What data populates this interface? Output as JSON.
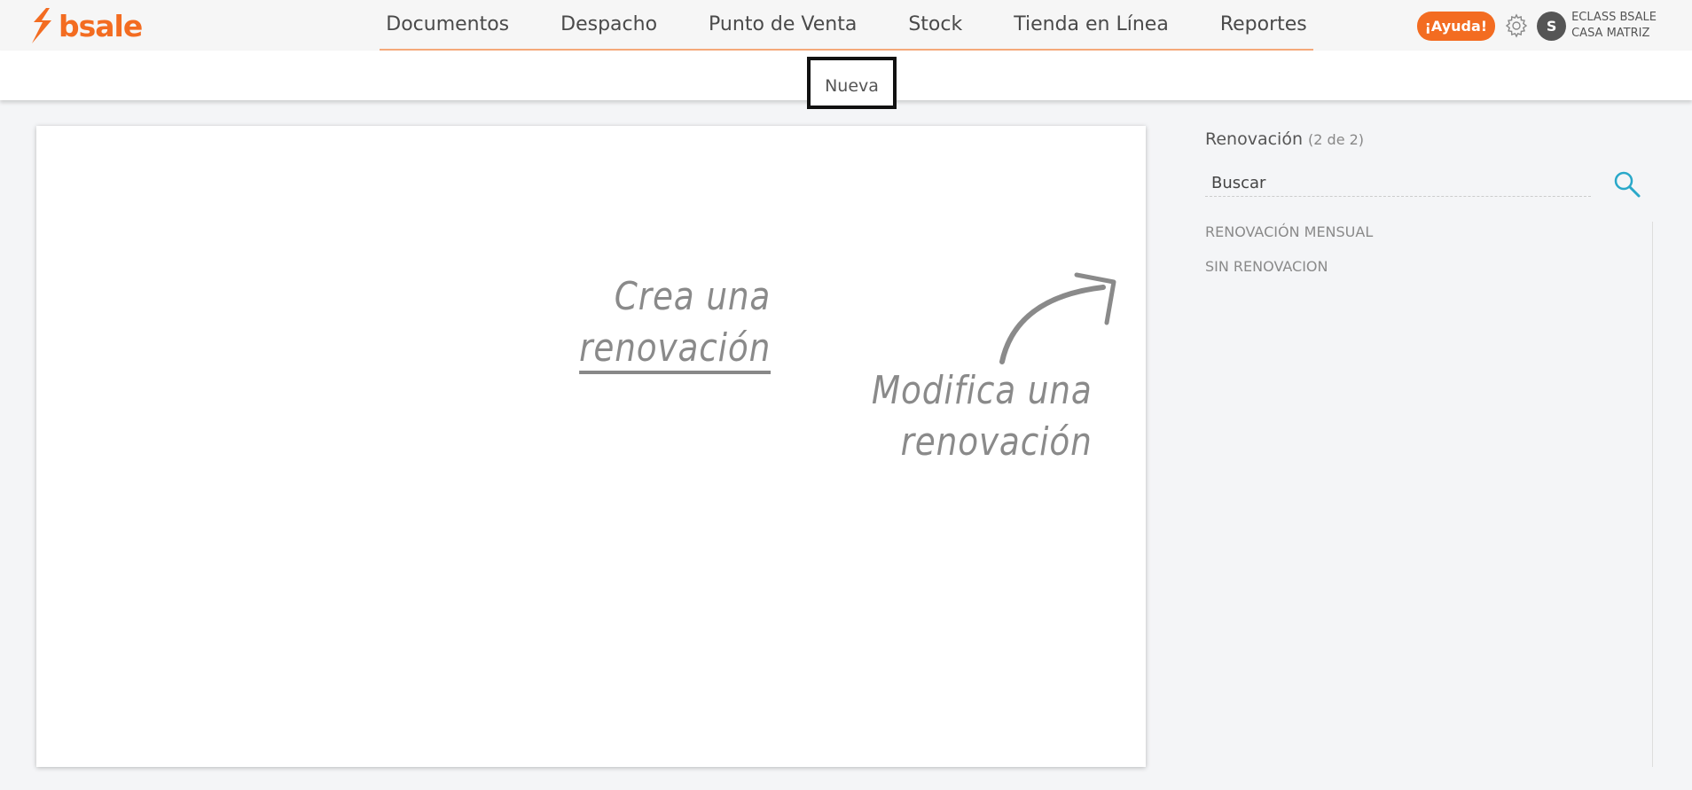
{
  "brand": {
    "name": "bsale",
    "color": "#f36c21"
  },
  "nav": {
    "items": [
      {
        "label": "Documentos"
      },
      {
        "label": "Despacho"
      },
      {
        "label": "Punto de Venta"
      },
      {
        "label": "Stock"
      },
      {
        "label": "Tienda en Línea"
      },
      {
        "label": "Reportes"
      }
    ]
  },
  "header": {
    "help_label": "¡Ayuda!",
    "avatar_initial": "S",
    "account_line1": "ECLASS BSALE",
    "account_line2": "CASA MATRIZ",
    "gear_icon": "gear-icon"
  },
  "subnav": {
    "new_label": "Nueva"
  },
  "canvas": {
    "create_line1": "Crea una",
    "create_line2": "renovación",
    "modify_line1": "Modifica una",
    "modify_line2": "renovación"
  },
  "sidebar": {
    "title": "Renovación",
    "count": "(2 de 2)",
    "search_placeholder": "Buscar",
    "search_icon": "search-icon",
    "accent": "#29a8c9",
    "items": [
      {
        "label": "RENOVACIÓN MENSUAL"
      },
      {
        "label": "SIN RENOVACION"
      }
    ]
  }
}
